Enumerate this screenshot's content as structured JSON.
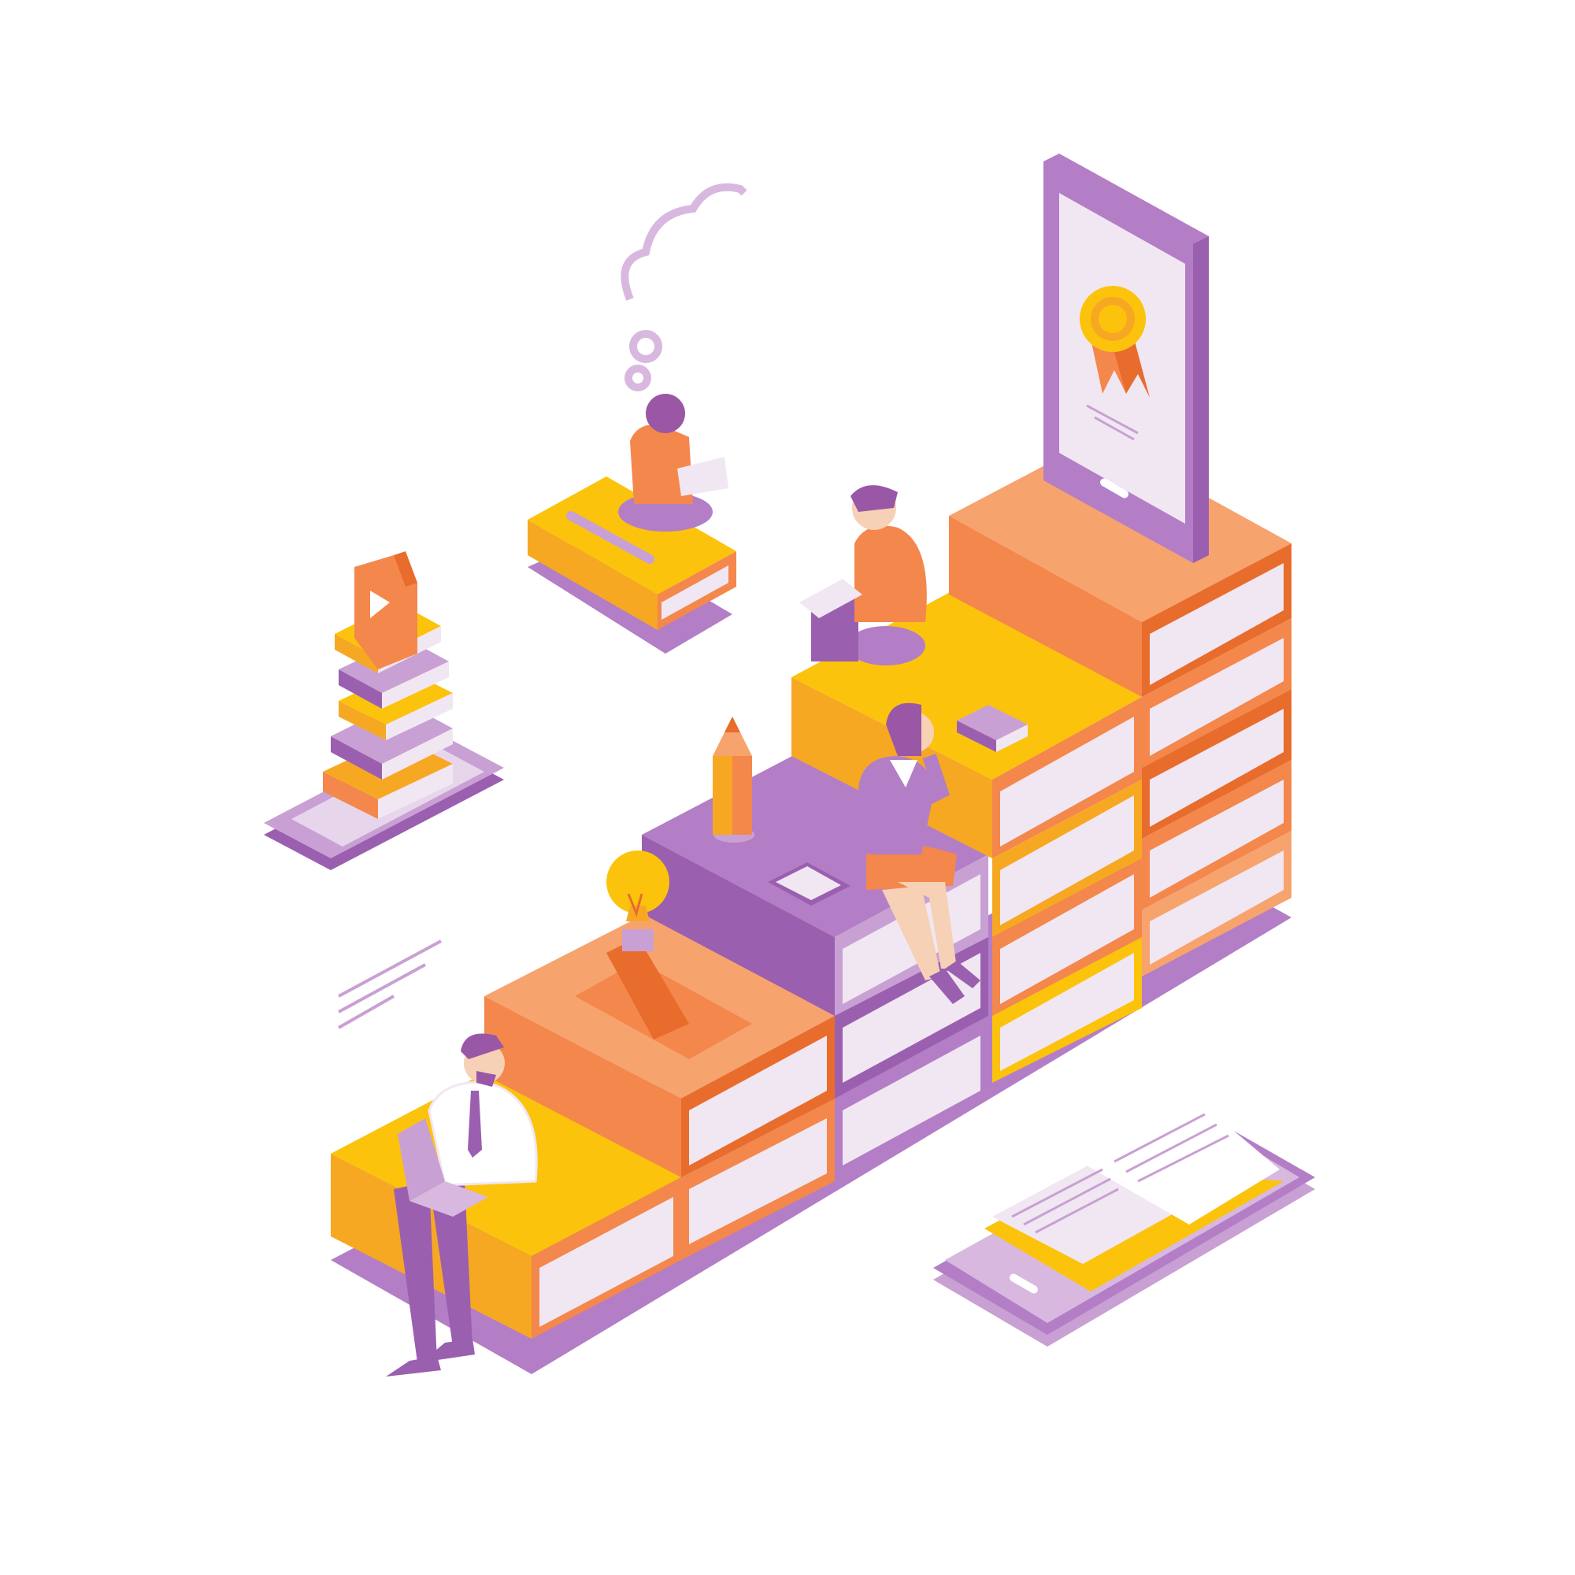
{
  "scene": {
    "background": "#ffffff",
    "palette": {
      "purple_light": "#c9a0d3",
      "purple": "#b37ec6",
      "purple_dark": "#9b5fb0",
      "orange_light": "#f7a36e",
      "orange": "#f4874c",
      "orange_dark": "#e86c2c",
      "yellow": "#fcc30c",
      "yellow_dark": "#f7a823",
      "page_white": "#f1e7f3",
      "skin": "#f6d1b5",
      "hair": "#9a57a6"
    },
    "objects": {
      "book_staircase": "stacked-books-staircase",
      "certificate_phone": "phone-with-award-ribbon",
      "video_phone": "phone-with-book-stack-and-play-card",
      "reader_phone": "phone-with-open-book",
      "thought_cloud": "thought-cloud",
      "lightbulb": "lightbulb-icon",
      "pencil": "pencil-icon",
      "tablet": "tablet-icon",
      "closed_book": "closed-book-icon"
    },
    "people": {
      "man_laptop": "man-with-laptop",
      "woman_phone_call": "woman-on-phone",
      "man_reading": "man-reading-book",
      "woman_reading_cloud": "woman-reading-on-book"
    }
  }
}
